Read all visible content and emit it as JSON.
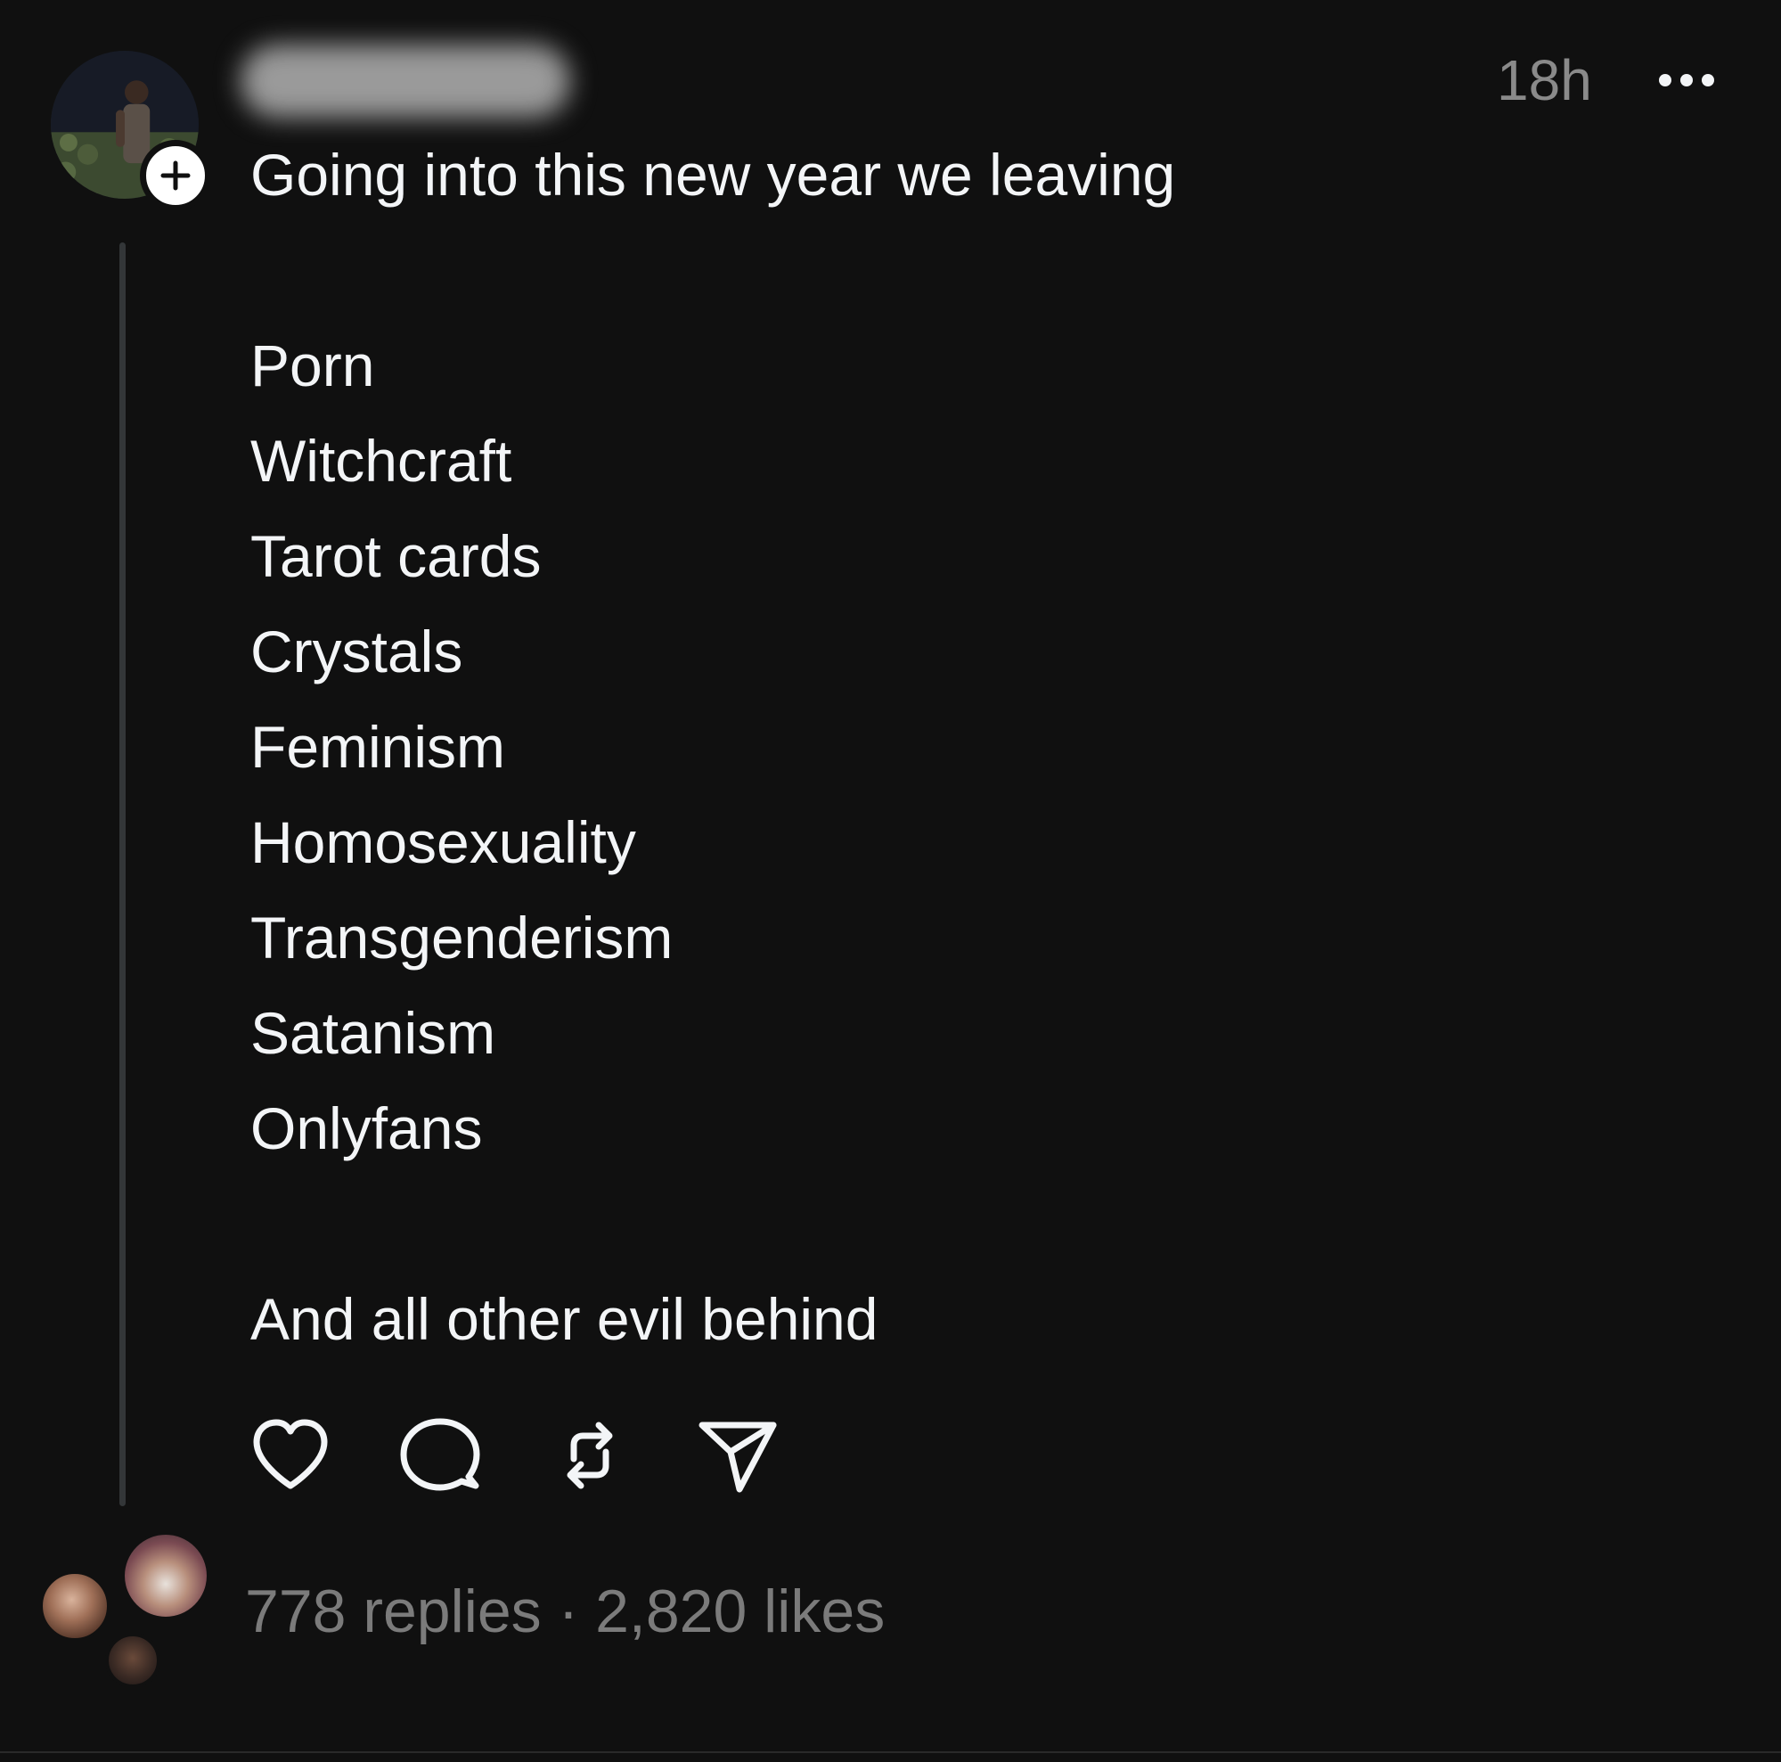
{
  "post": {
    "timestamp": "18h",
    "intro": "Going into this new year we leaving",
    "items": [
      "Porn",
      "Witchcraft",
      "Tarot cards",
      "Crystals",
      "Feminism",
      "Homosexuality",
      "Transgenderism",
      "Satanism",
      "Onlyfans"
    ],
    "closing": "And all other evil behind"
  },
  "actions": {
    "like_icon": "heart-icon",
    "reply_icon": "comment-icon",
    "repost_icon": "repost-icon",
    "share_icon": "send-icon"
  },
  "stats": {
    "replies": "778 replies",
    "separator": " · ",
    "likes": "2,820 likes"
  },
  "colors": {
    "background": "#101010",
    "text": "#f3f5f7",
    "secondary_text": "#7b7b7b"
  }
}
